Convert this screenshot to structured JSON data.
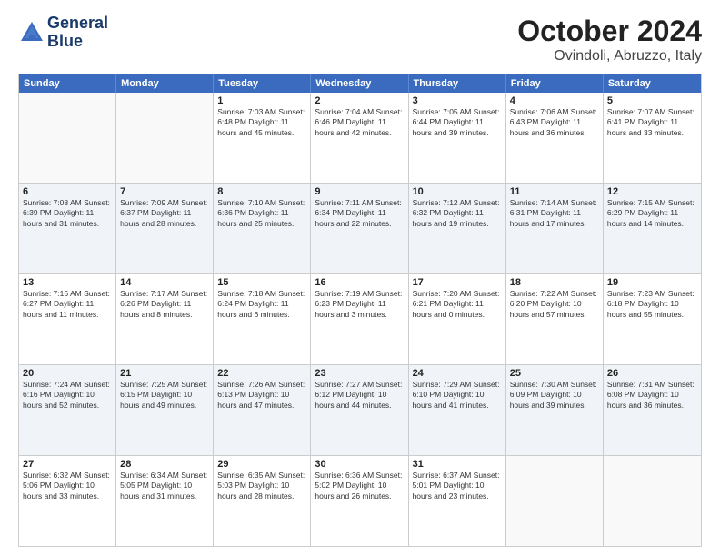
{
  "header": {
    "logo_line1": "General",
    "logo_line2": "Blue",
    "title": "October 2024",
    "subtitle": "Ovindoli, Abruzzo, Italy"
  },
  "days_of_week": [
    "Sunday",
    "Monday",
    "Tuesday",
    "Wednesday",
    "Thursday",
    "Friday",
    "Saturday"
  ],
  "rows": [
    [
      {
        "day": "",
        "info": ""
      },
      {
        "day": "",
        "info": ""
      },
      {
        "day": "1",
        "info": "Sunrise: 7:03 AM\nSunset: 6:48 PM\nDaylight: 11 hours and 45 minutes."
      },
      {
        "day": "2",
        "info": "Sunrise: 7:04 AM\nSunset: 6:46 PM\nDaylight: 11 hours and 42 minutes."
      },
      {
        "day": "3",
        "info": "Sunrise: 7:05 AM\nSunset: 6:44 PM\nDaylight: 11 hours and 39 minutes."
      },
      {
        "day": "4",
        "info": "Sunrise: 7:06 AM\nSunset: 6:43 PM\nDaylight: 11 hours and 36 minutes."
      },
      {
        "day": "5",
        "info": "Sunrise: 7:07 AM\nSunset: 6:41 PM\nDaylight: 11 hours and 33 minutes."
      }
    ],
    [
      {
        "day": "6",
        "info": "Sunrise: 7:08 AM\nSunset: 6:39 PM\nDaylight: 11 hours and 31 minutes."
      },
      {
        "day": "7",
        "info": "Sunrise: 7:09 AM\nSunset: 6:37 PM\nDaylight: 11 hours and 28 minutes."
      },
      {
        "day": "8",
        "info": "Sunrise: 7:10 AM\nSunset: 6:36 PM\nDaylight: 11 hours and 25 minutes."
      },
      {
        "day": "9",
        "info": "Sunrise: 7:11 AM\nSunset: 6:34 PM\nDaylight: 11 hours and 22 minutes."
      },
      {
        "day": "10",
        "info": "Sunrise: 7:12 AM\nSunset: 6:32 PM\nDaylight: 11 hours and 19 minutes."
      },
      {
        "day": "11",
        "info": "Sunrise: 7:14 AM\nSunset: 6:31 PM\nDaylight: 11 hours and 17 minutes."
      },
      {
        "day": "12",
        "info": "Sunrise: 7:15 AM\nSunset: 6:29 PM\nDaylight: 11 hours and 14 minutes."
      }
    ],
    [
      {
        "day": "13",
        "info": "Sunrise: 7:16 AM\nSunset: 6:27 PM\nDaylight: 11 hours and 11 minutes."
      },
      {
        "day": "14",
        "info": "Sunrise: 7:17 AM\nSunset: 6:26 PM\nDaylight: 11 hours and 8 minutes."
      },
      {
        "day": "15",
        "info": "Sunrise: 7:18 AM\nSunset: 6:24 PM\nDaylight: 11 hours and 6 minutes."
      },
      {
        "day": "16",
        "info": "Sunrise: 7:19 AM\nSunset: 6:23 PM\nDaylight: 11 hours and 3 minutes."
      },
      {
        "day": "17",
        "info": "Sunrise: 7:20 AM\nSunset: 6:21 PM\nDaylight: 11 hours and 0 minutes."
      },
      {
        "day": "18",
        "info": "Sunrise: 7:22 AM\nSunset: 6:20 PM\nDaylight: 10 hours and 57 minutes."
      },
      {
        "day": "19",
        "info": "Sunrise: 7:23 AM\nSunset: 6:18 PM\nDaylight: 10 hours and 55 minutes."
      }
    ],
    [
      {
        "day": "20",
        "info": "Sunrise: 7:24 AM\nSunset: 6:16 PM\nDaylight: 10 hours and 52 minutes."
      },
      {
        "day": "21",
        "info": "Sunrise: 7:25 AM\nSunset: 6:15 PM\nDaylight: 10 hours and 49 minutes."
      },
      {
        "day": "22",
        "info": "Sunrise: 7:26 AM\nSunset: 6:13 PM\nDaylight: 10 hours and 47 minutes."
      },
      {
        "day": "23",
        "info": "Sunrise: 7:27 AM\nSunset: 6:12 PM\nDaylight: 10 hours and 44 minutes."
      },
      {
        "day": "24",
        "info": "Sunrise: 7:29 AM\nSunset: 6:10 PM\nDaylight: 10 hours and 41 minutes."
      },
      {
        "day": "25",
        "info": "Sunrise: 7:30 AM\nSunset: 6:09 PM\nDaylight: 10 hours and 39 minutes."
      },
      {
        "day": "26",
        "info": "Sunrise: 7:31 AM\nSunset: 6:08 PM\nDaylight: 10 hours and 36 minutes."
      }
    ],
    [
      {
        "day": "27",
        "info": "Sunrise: 6:32 AM\nSunset: 5:06 PM\nDaylight: 10 hours and 33 minutes."
      },
      {
        "day": "28",
        "info": "Sunrise: 6:34 AM\nSunset: 5:05 PM\nDaylight: 10 hours and 31 minutes."
      },
      {
        "day": "29",
        "info": "Sunrise: 6:35 AM\nSunset: 5:03 PM\nDaylight: 10 hours and 28 minutes."
      },
      {
        "day": "30",
        "info": "Sunrise: 6:36 AM\nSunset: 5:02 PM\nDaylight: 10 hours and 26 minutes."
      },
      {
        "day": "31",
        "info": "Sunrise: 6:37 AM\nSunset: 5:01 PM\nDaylight: 10 hours and 23 minutes."
      },
      {
        "day": "",
        "info": ""
      },
      {
        "day": "",
        "info": ""
      }
    ]
  ]
}
